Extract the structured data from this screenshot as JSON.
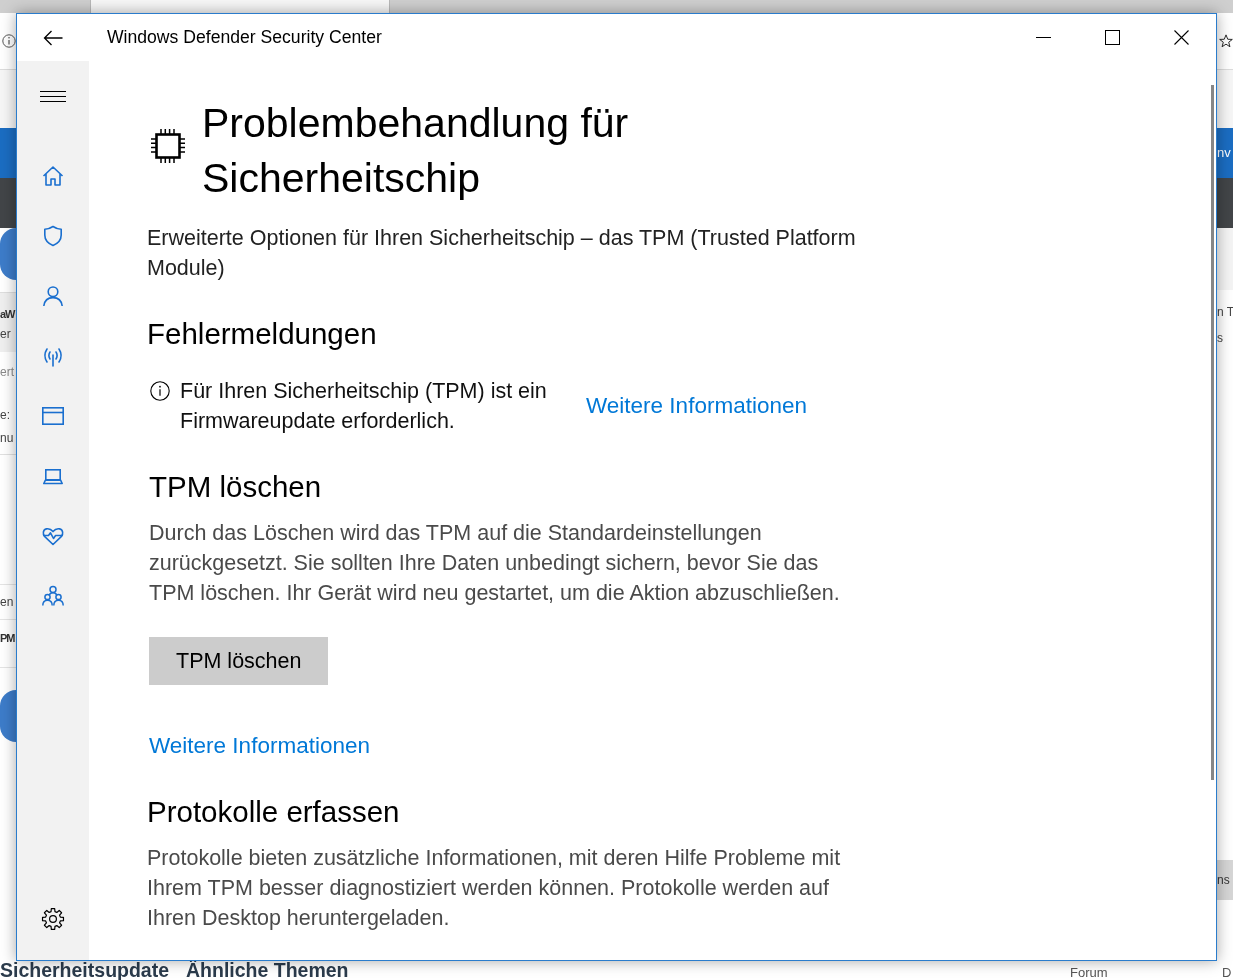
{
  "browser_background": {
    "left_fragments": [
      {
        "text": "aW",
        "kind": "title"
      },
      {
        "text": "er",
        "kind": "meta"
      },
      {
        "text": "ert",
        "kind": "hint"
      },
      {
        "text": "e:",
        "kind": "meta"
      },
      {
        "text": "nu",
        "kind": "meta"
      },
      {
        "text": "en",
        "kind": "meta"
      },
      {
        "text": "PM",
        "kind": "title"
      }
    ],
    "right_fragments": [
      {
        "text": "nv",
        "kind": "banner"
      },
      {
        "text": "n T",
        "kind": "meta"
      },
      {
        "text": "s",
        "kind": "meta"
      },
      {
        "text": "ns",
        "kind": "button"
      }
    ],
    "footer_links": [
      "Sicherheitsupdate",
      "Ähnliche Themen"
    ],
    "footer_meta": [
      "Forum",
      "D"
    ]
  },
  "window": {
    "title": "Windows Defender Security Center"
  },
  "page": {
    "title": "Problembehandlung für Sicherheitschip",
    "description": "Erweiterte Optionen für Ihren Sicherheitschip – das TPM (Trusted Platform Module)",
    "sections": [
      {
        "kind": "messages",
        "heading": "Fehlermeldungen",
        "messages": [
          {
            "text": "Für Ihren Sicherheitschip (TPM) ist ein Firmwareupdate erforderlich.",
            "link": "Weitere Informationen"
          }
        ]
      },
      {
        "kind": "action",
        "heading": "TPM löschen",
        "text": "Durch das Löschen wird das TPM auf die Standardeinstellungen zurückgesetzt. Sie sollten Ihre Daten unbedingt sichern, bevor Sie das TPM löschen. Ihr Gerät wird neu gestartet, um die Aktion abzuschließen.",
        "button": "TPM löschen",
        "link": "Weitere Informationen"
      },
      {
        "kind": "text",
        "heading": "Protokolle erfassen",
        "text": "Protokolle bieten zusätzliche Informationen, mit deren Hilfe Probleme mit Ihrem TPM besser diagnostiziert werden können. Protokolle werden auf Ihren Desktop heruntergeladen."
      }
    ]
  }
}
